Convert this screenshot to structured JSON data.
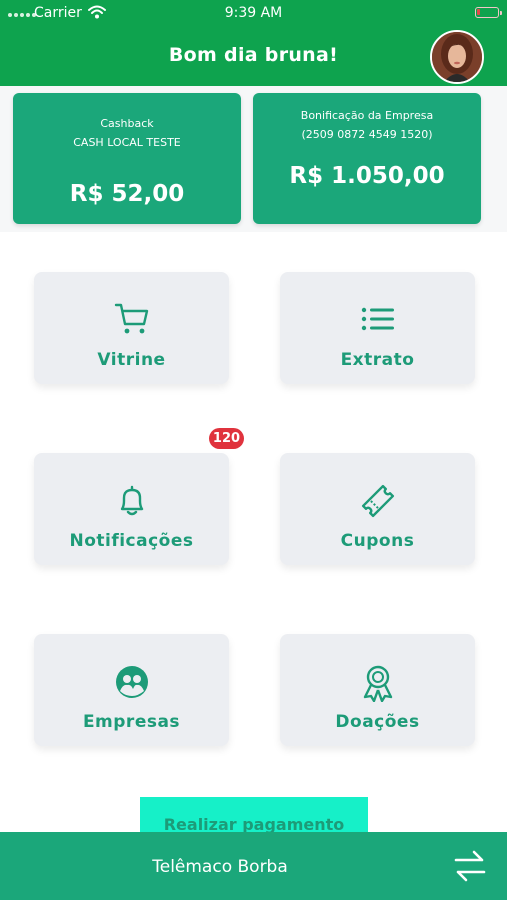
{
  "status_bar": {
    "carrier": "Carrier",
    "time": "9:39 AM"
  },
  "header": {
    "greeting": "Bom dia bruna!"
  },
  "balances": [
    {
      "line1": "Cashback",
      "line2": "CASH LOCAL TESTE",
      "amount": "R$ 52,00"
    },
    {
      "line1": "Bonificação da Empresa",
      "line2": "(2509 0872 4549 1520)",
      "amount": "R$ 1.050,00"
    }
  ],
  "menu": [
    {
      "label": "Vitrine",
      "icon": "cart-icon"
    },
    {
      "label": "Extrato",
      "icon": "list-icon"
    },
    {
      "label": "Notificações",
      "icon": "bell-icon",
      "badge": "120"
    },
    {
      "label": "Cupons",
      "icon": "ticket-icon"
    },
    {
      "label": "Empresas",
      "icon": "people-icon"
    },
    {
      "label": "Doações",
      "icon": "ribbon-icon"
    }
  ],
  "pay_button": {
    "label": "Realizar pagamento"
  },
  "footer": {
    "city": "Telêmaco Borba",
    "icon": "swap-icon"
  },
  "colors": {
    "header": "#0ea34e",
    "accent": "#1ba77a",
    "tile_text": "#1d9b78",
    "badge": "#e0333d"
  }
}
